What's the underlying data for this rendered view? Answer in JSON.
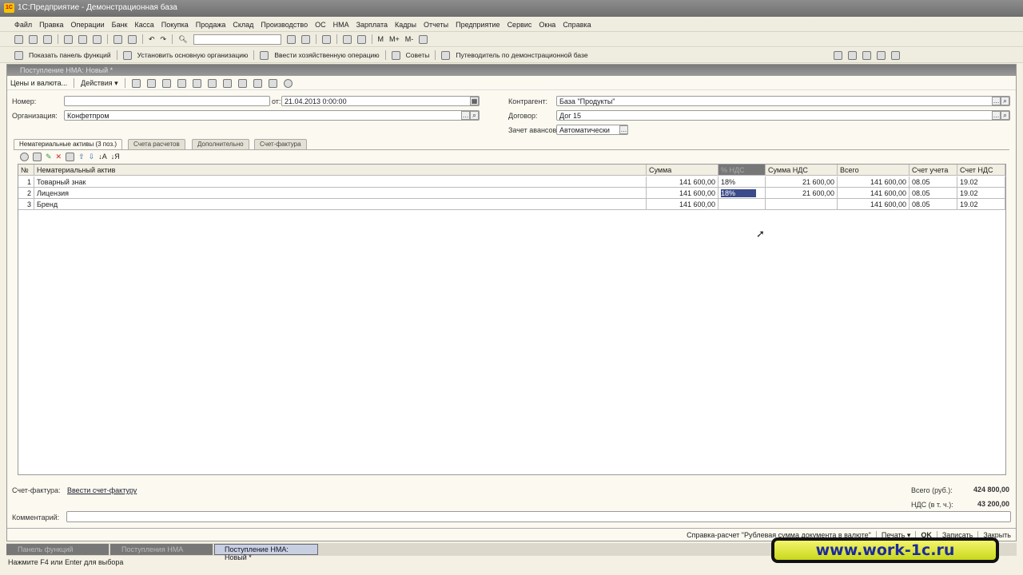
{
  "window": {
    "title": "1С:Предприятие - Демонстрационная база"
  },
  "menu": [
    "Файл",
    "Правка",
    "Операции",
    "Банк",
    "Касса",
    "Покупка",
    "Продажа",
    "Склад",
    "Производство",
    "ОС",
    "НМА",
    "Зарплата",
    "Кадры",
    "Отчеты",
    "Предприятие",
    "Сервис",
    "Окна",
    "Справка"
  ],
  "toolbar1": {
    "calc": [
      "М",
      "М+",
      "М-"
    ]
  },
  "toolbar2": [
    "Показать панель функций",
    "Установить основную организацию",
    "Ввести хозяйственную операцию",
    "Советы",
    "Путеводитель по демонстрационной базе"
  ],
  "doc": {
    "title": "Поступление НМА: Новый *",
    "toolbar": {
      "prices": "Цены и валюта...",
      "actions": "Действия"
    },
    "fields": {
      "number_label": "Номер:",
      "number": "",
      "date_label": "от:",
      "date": "21.04.2013  0:00:00",
      "org_label": "Организация:",
      "org": "Конфетпром",
      "contractor_label": "Контрагент:",
      "contractor": "База \"Продукты\"",
      "contract_label": "Договор:",
      "contract": "Дог 15",
      "advance_label": "Зачет авансов:",
      "advance": "Автоматически"
    },
    "tabs": [
      "Нематериальные активы (3 поз.)",
      "Счета расчетов",
      "Дополнительно",
      "Счет-фактура"
    ],
    "table": {
      "columns": [
        "№",
        "Нематериальный актив",
        "Сумма",
        "% НДС",
        "Сумма НДС",
        "Всего",
        "Счет учета",
        "Счет НДС"
      ],
      "rows": [
        [
          "1",
          "Товарный знак",
          "141 600,00",
          "18%",
          "21 600,00",
          "141 600,00",
          "08.05",
          "19.02"
        ],
        [
          "2",
          "Лицензия",
          "141 600,00",
          "18%",
          "21 600,00",
          "141 600,00",
          "08.05",
          "19.02"
        ],
        [
          "3",
          "Бренд",
          "141 600,00",
          "",
          "",
          "141 600,00",
          "08.05",
          "19.02"
        ]
      ]
    },
    "invoice_label": "Счет-фактура:",
    "invoice_link": "Ввести счет-фактуру",
    "total_label": "Всего (руб.):",
    "total": "424 800,00",
    "vat_label": "НДС (в т. ч.):",
    "vat": "43 200,00",
    "comment_label": "Комментарий:",
    "comment": "",
    "buttons": {
      "calc": "Справка-расчет \"Рублевая сумма документа в валюте\"",
      "print": "Печать",
      "ok": "OK",
      "save": "Записать",
      "close": "Закрыть"
    }
  },
  "taskbar": [
    "Панель функций",
    "Поступления НМА",
    "Поступление НМА: Новый *"
  ],
  "status": "Нажмите F4 или Enter для выбора",
  "watermark": "www.work-1c.ru"
}
